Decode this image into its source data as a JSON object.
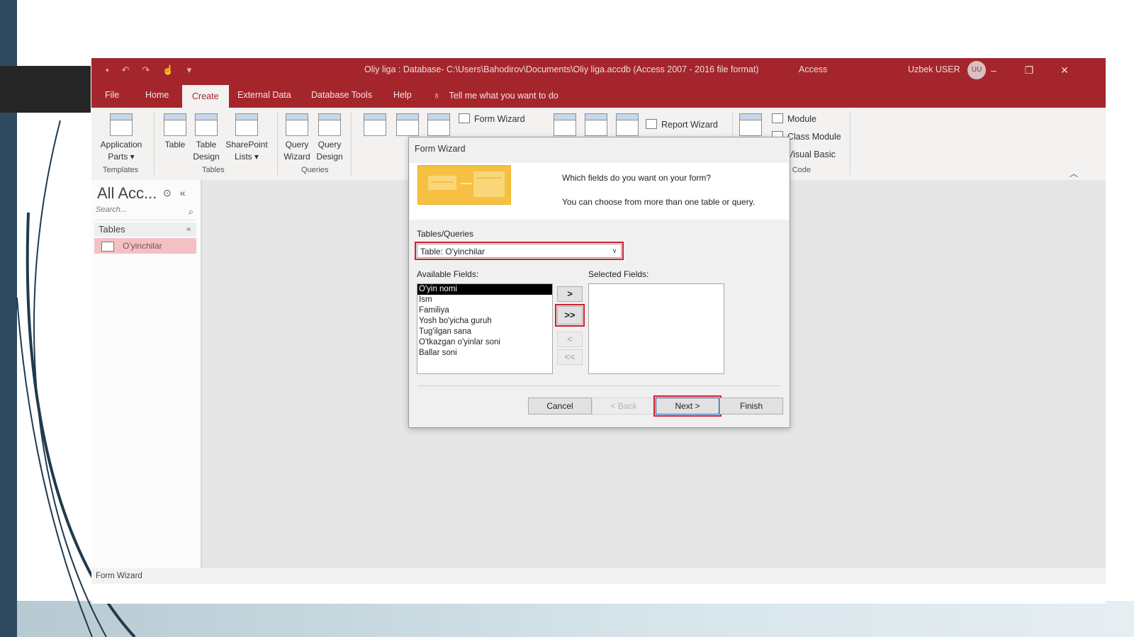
{
  "titlebar": {
    "title": "Oliy liga : Database- C:\\Users\\Bahodirov\\Documents\\Oliy liga.accdb (Access 2007 - 2016 file format)",
    "app_name": "Access",
    "user": "Uzbek USER",
    "avatar": "UU"
  },
  "tabs": [
    "File",
    "Home",
    "Create",
    "External Data",
    "Database Tools",
    "Help"
  ],
  "active_tab": "Create",
  "tell_me": "Tell me what you want to do",
  "ribbon": {
    "templates": {
      "app_parts": "Application",
      "app_parts2": "Parts ▾",
      "label": "Templates"
    },
    "tables": {
      "table": "Table",
      "table_design1": "Table",
      "table_design2": "Design",
      "sharepoint1": "SharePoint",
      "sharepoint2": "Lists ▾",
      "label": "Tables"
    },
    "queries": {
      "qw1": "Query",
      "qw2": "Wizard",
      "qd1": "Query",
      "qd2": "Design",
      "label": "Queries"
    },
    "forms": {
      "form_wizard": "Form Wizard"
    },
    "reports": {
      "report_wizard": "Report Wizard"
    },
    "macros": {
      "module": "Module",
      "class_module": "Class Module",
      "visual_basic": "Visual Basic",
      "label": "ros & Code"
    }
  },
  "navpane": {
    "heading": "All Acc...",
    "search_placeholder": "Search...",
    "section": "Tables",
    "items": [
      "O'yinchilar"
    ]
  },
  "statusbar": "Form Wizard",
  "dialog": {
    "title": "Form Wizard",
    "question1": "Which fields do you want on your form?",
    "question2": "You can choose from more than one table or query.",
    "tables_label": "Tables/Queries",
    "combo_value": "Table: O'yinchilar",
    "available_label": "Available Fields:",
    "selected_label": "Selected Fields:",
    "available_fields": [
      "O'yin nomi",
      "Ism",
      "Familiya",
      "Yosh bo'yicha guruh",
      "Tug'ilgan sana",
      "O'tkazgan o'yinlar soni",
      "Ballar soni"
    ],
    "selected_field_index": 0,
    "move": {
      "one": ">",
      "all": ">>",
      "back_one": "<",
      "back_all": "<<"
    },
    "buttons": {
      "cancel": "Cancel",
      "back": "< Back",
      "next": "Next >",
      "finish": "Finish"
    }
  },
  "colors": {
    "access_red": "#a4262c",
    "highlight": "#d0202e"
  }
}
